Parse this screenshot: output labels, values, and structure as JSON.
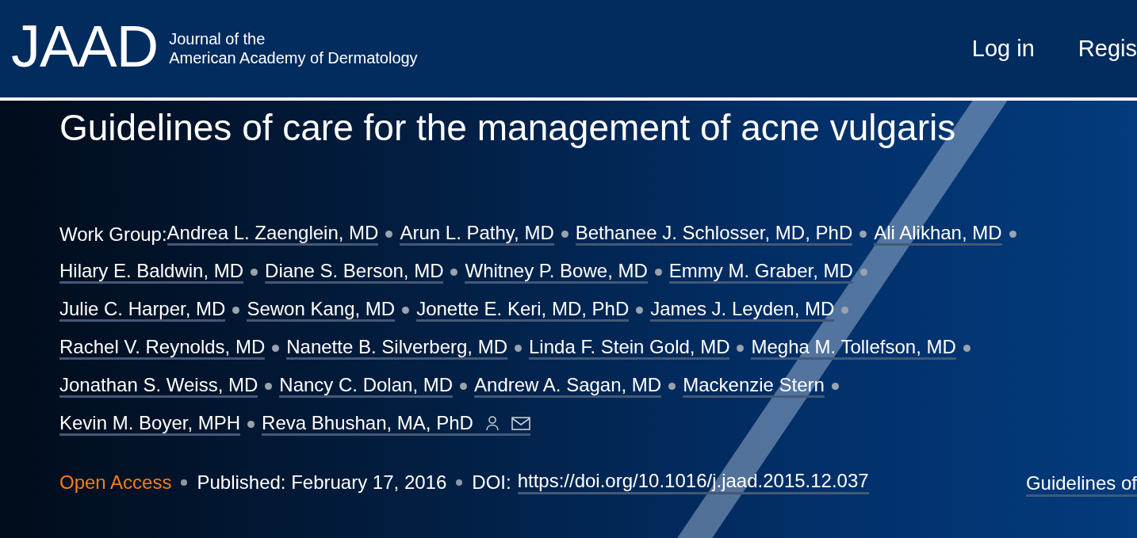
{
  "header": {
    "logo": "JAAD",
    "logo_subtitle_lines": [
      "Journal of the",
      "American Academy of Dermatology"
    ],
    "nav": [
      "Log in",
      "Regis"
    ]
  },
  "article": {
    "title": "Guidelines of care for the management of acne vulgaris",
    "authors_label": "Work Group:",
    "authors": [
      "Andrea L. Zaenglein, MD",
      "Arun L. Pathy, MD",
      "Bethanee J. Schlosser, MD, PhD",
      "Ali Alikhan, MD",
      "Hilary E. Baldwin, MD",
      "Diane S. Berson, MD",
      "Whitney P. Bowe, MD",
      "Emmy M. Graber, MD",
      "Julie C. Harper, MD",
      "Sewon Kang, MD",
      "Jonette E. Keri, MD, PhD",
      "James J. Leyden, MD",
      "Rachel V. Reynolds, MD",
      "Nanette B. Silverberg, MD",
      "Linda F. Stein Gold, MD",
      "Megha M. Tollefson, MD",
      "Jonathan S. Weiss, MD",
      "Nancy C. Dolan, MD",
      "Andrew A. Sagan, MD",
      "Mackenzie Stern",
      "Kevin M. Boyer, MPH",
      "Reva Bhushan, MA, PhD"
    ],
    "access": "Open Access",
    "published": "Published: February 17, 2016",
    "doi_label": "DOI:",
    "doi": "https://doi.org/10.1016/j.jaad.2015.12.037",
    "related_link": "Guidelines of"
  }
}
